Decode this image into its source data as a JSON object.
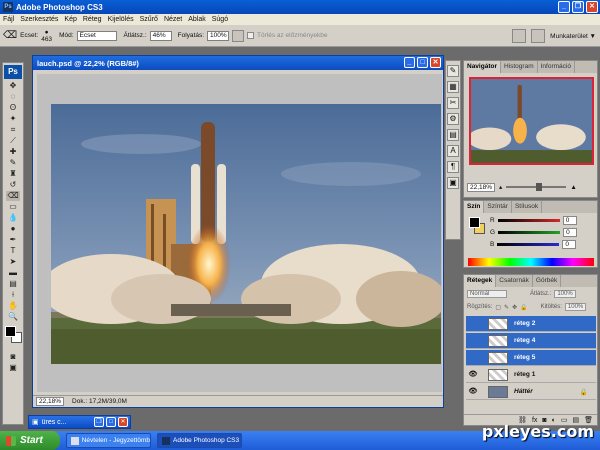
{
  "app": {
    "title": "Adobe Photoshop CS3",
    "ps_badge": "Ps"
  },
  "menu": [
    "Fájl",
    "Szerkesztés",
    "Kép",
    "Réteg",
    "Kijelölés",
    "Szűrő",
    "Nézet",
    "Ablak",
    "Súgó"
  ],
  "options": {
    "brush_label": "Ecset:",
    "brush_size": "463",
    "mode_label": "Mód:",
    "mode_value": "Ecset",
    "opacity_label": "Átlátsz.:",
    "opacity_value": "46%",
    "flow_label": "Folyatás:",
    "flow_value": "100%",
    "erase_history": "Törlés az előzményekbe",
    "workspace": "Munkaterület ▼"
  },
  "document": {
    "title": "lauch.psd @ 22,2% (RGB/8#)",
    "zoom": "22,18%",
    "doc_info": "Dok.: 17,2M/39,0M"
  },
  "navigator": {
    "tabs": [
      "Navigátor",
      "Histogram",
      "Információ"
    ],
    "zoom": "22,18%",
    "slider_level": 0.55
  },
  "color_panel": {
    "tabs": [
      "Szín",
      "Színtár",
      "Stílusok"
    ],
    "channels": [
      {
        "label": "R",
        "value": "0",
        "color": "#d22a2a"
      },
      {
        "label": "G",
        "value": "0",
        "color": "#22a22a"
      },
      {
        "label": "B",
        "value": "0",
        "color": "#2a2ad2"
      }
    ]
  },
  "layers_panel": {
    "tabs": [
      "Rétegek",
      "Csatornák",
      "Görbék"
    ],
    "blend_mode": "Normál",
    "opacity_label": "Átlátsz.:",
    "opacity_value": "100%",
    "lock_label": "Rögzítés:",
    "fill_label": "Kitöltés:",
    "fill_value": "100%",
    "layers": [
      {
        "name": "réteg 2",
        "selected": true,
        "visible": false
      },
      {
        "name": "réteg 4",
        "selected": true,
        "visible": false
      },
      {
        "name": "réteg 5",
        "selected": true,
        "visible": false
      },
      {
        "name": "réteg 1",
        "selected": false,
        "visible": true
      },
      {
        "name": "Háttér",
        "selected": false,
        "visible": true,
        "locked": true
      }
    ]
  },
  "minimized_window": {
    "title": "üres c..."
  },
  "taskbar": {
    "start": "Start",
    "items": [
      "Névtelen - Jegyzettömb",
      "Adobe Photoshop CS3"
    ]
  },
  "watermark": "pxleyes.com",
  "colors": {
    "xp_blue": "#0c4cc0",
    "selection_blue": "#3169c6",
    "panel_gray": "#d4d0c8"
  }
}
